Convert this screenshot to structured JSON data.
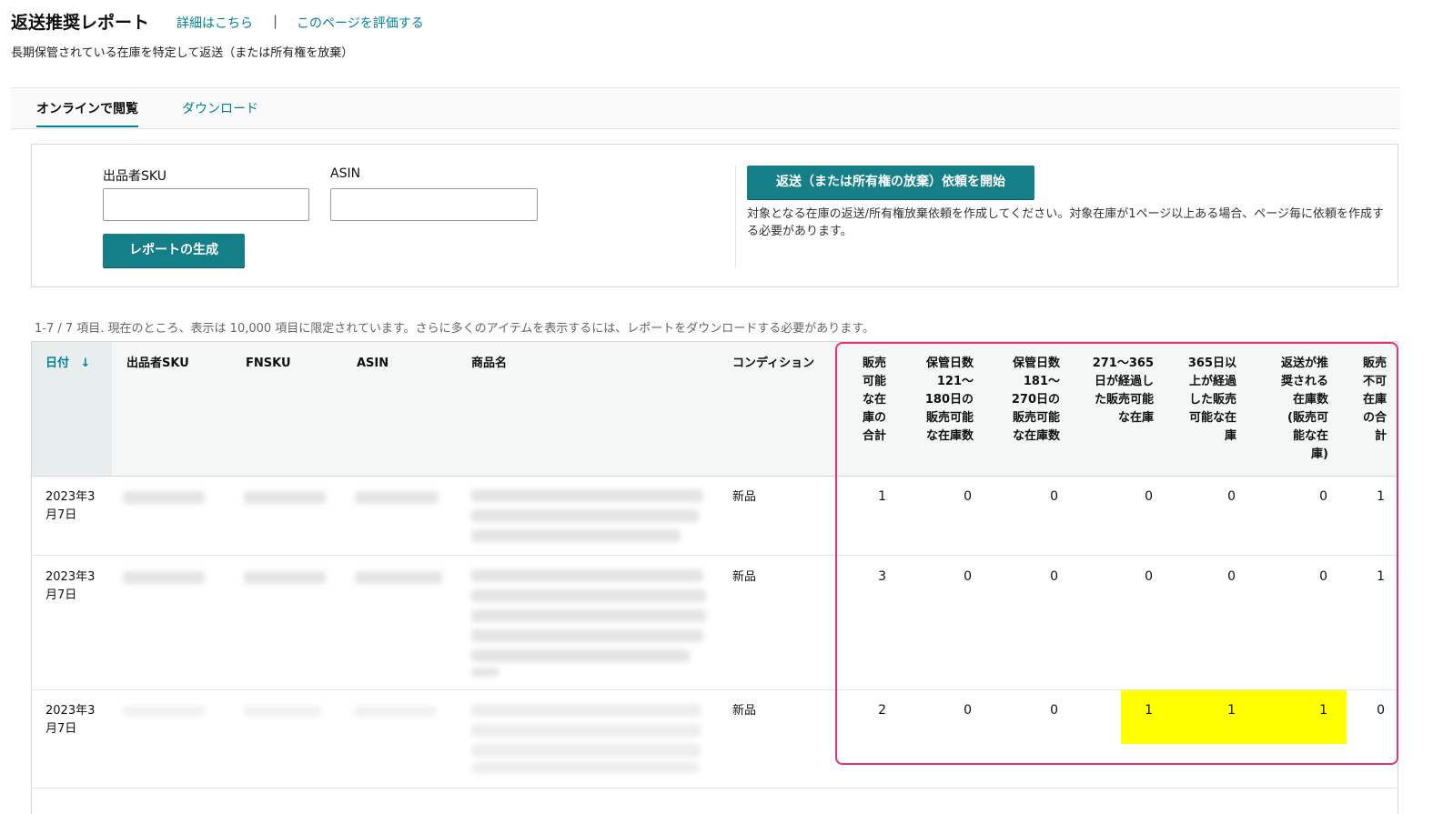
{
  "header": {
    "title": "返送推奨レポート",
    "details_link": "詳細はこちら",
    "separator": "|",
    "rate_link": "このページを評価する",
    "subtitle": "長期保管されている在庫を特定して返送（または所有権を放棄）"
  },
  "tabs": [
    "オンラインで閲覧",
    "ダウンロード"
  ],
  "filters": {
    "sku_label": "出品者SKU",
    "asin_label": "ASIN",
    "generate_button": "レポートの生成",
    "removal_button": "返送（または所有権の放棄）依頼を開始",
    "removal_info": "対象となる在庫の返送/所有権放棄依頼を作成してください。対象在庫が1ページ以上ある場合、ページ毎に依頼を作成する必要があります。"
  },
  "table": {
    "count_text": "1-7 / 7 項目. 現在のところ、表示は 10,000 項目に限定されています。さらに多くのアイテムを表示するには、レポートをダウンロードする必要があります。",
    "sort_arrow": "↓",
    "headers": {
      "date": "日付",
      "sku": "出品者SKU",
      "fnsku": "FNSKU",
      "asin": "ASIN",
      "name": "商品名",
      "condition": "コンディション",
      "sellable_total": [
        "販売",
        "可能",
        "な在",
        "庫の",
        "合計"
      ],
      "age_121_180": [
        "保管日数",
        "121～",
        "180日の",
        "販売可能",
        "な在庫数"
      ],
      "age_181_270": [
        "保管日数",
        "181～",
        "270日の",
        "販売可能",
        "な在庫数"
      ],
      "age_271_365": [
        "271～365",
        "日が経過し",
        "た販売可能",
        "な在庫"
      ],
      "age_365_plus": [
        "365日以",
        "上が経過",
        "した販売",
        "可能な在",
        "庫"
      ],
      "recommended": [
        "返送が推",
        "奨される",
        "在庫数",
        "(販売可",
        "能な在",
        "庫)"
      ],
      "unsellable_total": [
        "販売",
        "不可",
        "在庫",
        "の合",
        "計"
      ]
    },
    "rows": [
      {
        "date": [
          "2023年3",
          "月7日"
        ],
        "condition": "新品",
        "values": [
          "1",
          "0",
          "0",
          "0",
          "0",
          "0",
          "1"
        ]
      },
      {
        "date": [
          "2023年3",
          "月7日"
        ],
        "condition": "新品",
        "values": [
          "3",
          "0",
          "0",
          "0",
          "0",
          "0",
          "1"
        ]
      },
      {
        "date": [
          "2023年3",
          "月7日"
        ],
        "condition": "新品",
        "values": [
          "2",
          "0",
          "0",
          "1",
          "1",
          "1",
          "0"
        ]
      }
    ]
  },
  "colors": {
    "accent": "#008296",
    "button": "#157f87",
    "highlight": "#ffff00",
    "annotation_box": "#e8356b"
  }
}
